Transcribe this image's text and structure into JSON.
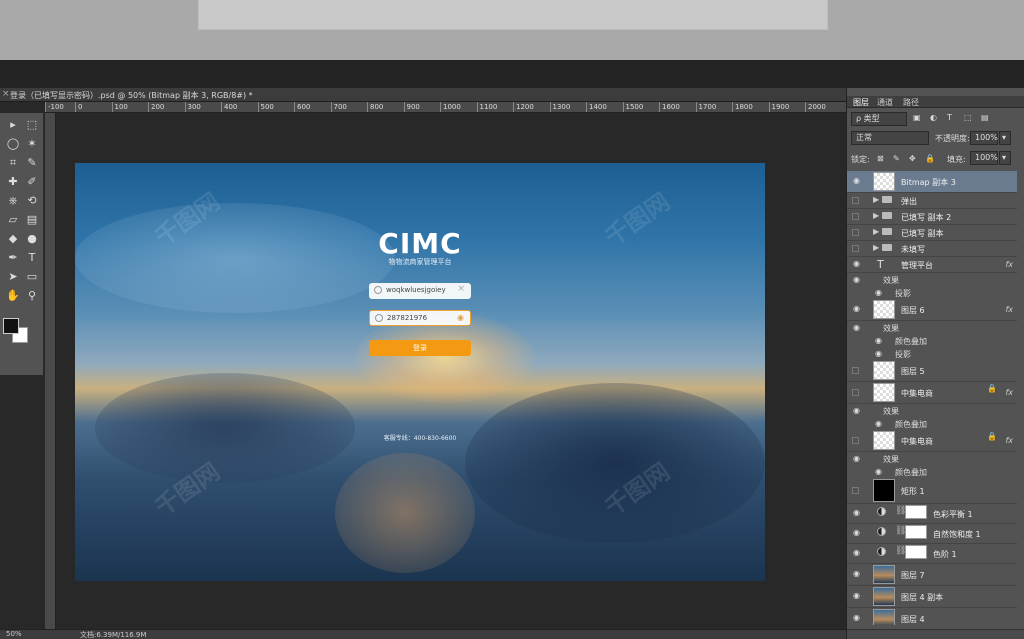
{
  "document": {
    "title": "登录（已填写显示密码）.psd @ 50% (Bitmap 副本 3, RGB/8#) *",
    "close_symbol": "×"
  },
  "ruler_labels": [
    "0",
    "100",
    "200",
    "300",
    "400",
    "500",
    "600",
    "700",
    "800",
    "900",
    "1000",
    "1100",
    "1200",
    "1300",
    "1400",
    "1500",
    "1600",
    "1700",
    "1800",
    "1900",
    "2000"
  ],
  "ruler_first": "-100",
  "tools": {
    "icons": [
      "move-icon",
      "marquee-icon",
      "lasso-icon",
      "magic-wand-icon",
      "crop-icon",
      "eyedropper-icon",
      "healing-brush-icon",
      "brush-icon",
      "clone-stamp-icon",
      "history-brush-icon",
      "eraser-icon",
      "gradient-icon",
      "blur-icon",
      "dodge-icon",
      "pen-icon",
      "type-icon",
      "path-select-icon",
      "shape-icon",
      "hand-icon",
      "zoom-icon"
    ],
    "glyphs": [
      "▸",
      "⬚",
      "◯",
      "✶",
      "⌗",
      "✎",
      "✚",
      "✐",
      "⎈",
      "⟲",
      "▱",
      "▤",
      "◆",
      "●",
      "✒",
      "T",
      "➤",
      "▭",
      "✋",
      "⚲"
    ],
    "foreground_color": "#111111",
    "background_color": "#ffffff"
  },
  "artboard": {
    "logo": "CIMC",
    "subtitle": "物物流商家管理平台",
    "username_value": "woqkwluesjgoiey",
    "password_value": "287821976",
    "clear_symbol": "×",
    "login_label": "登录",
    "hotline": "客服专线：400-830-6600",
    "accent_color": "#f39a12"
  },
  "panel": {
    "tabs": [
      "图层",
      "通道",
      "路径"
    ],
    "filter_kind": "ρ 类型",
    "filter_icons": [
      "image-filter-icon",
      "adjustment-filter-icon",
      "type-filter-icon",
      "shape-filter-icon",
      "smart-object-filter-icon"
    ],
    "filter_glyphs": [
      "▣",
      "◐",
      "T",
      "⬚",
      "▤"
    ],
    "blend_mode": "正常",
    "opacity_label": "不透明度:",
    "opacity_value": "100%",
    "lock_label": "锁定:",
    "lock_glyphs": [
      "⊠",
      "✎",
      "✥",
      "🔒"
    ],
    "fill_label": "填充:",
    "fill_value": "100%"
  },
  "layers": [
    {
      "name": "Bitmap 副本 3",
      "kind": "pixel",
      "visible": true,
      "selected": true
    },
    {
      "name": "弹出",
      "kind": "group",
      "visible": false
    },
    {
      "name": "已填写 副本 2",
      "kind": "group",
      "visible": false
    },
    {
      "name": "已填写 副本",
      "kind": "group",
      "visible": false
    },
    {
      "name": "未填写",
      "kind": "group",
      "visible": false
    },
    {
      "name": "管理平台",
      "kind": "type",
      "visible": true,
      "fx": "fx",
      "effects_label": "效果",
      "effects": [
        "投影"
      ]
    },
    {
      "name": "图层 6",
      "kind": "pixel",
      "visible": true,
      "fx": "fx",
      "effects_label": "效果",
      "effects": [
        "颜色叠加",
        "投影"
      ]
    },
    {
      "name": "图层 5",
      "kind": "pixel",
      "visible": false
    },
    {
      "name": "中集电商",
      "kind": "smart",
      "visible": false,
      "fx": "fx",
      "effects_label": "效果",
      "effects": [
        "颜色叠加"
      ]
    },
    {
      "name": "中集电商",
      "kind": "smart",
      "visible": false,
      "fx": "fx",
      "effects_label": "效果",
      "effects": [
        "颜色叠加"
      ]
    },
    {
      "name": "矩形 1",
      "kind": "black",
      "visible": false
    },
    {
      "name": "色彩平衡 1",
      "kind": "adjustment",
      "visible": true
    },
    {
      "name": "自然饱和度 1",
      "kind": "adjustment",
      "visible": true
    },
    {
      "name": "色阶 1",
      "kind": "adjustment",
      "visible": true
    },
    {
      "name": "图层 7",
      "kind": "photo",
      "visible": true
    },
    {
      "name": "图层 4 副本",
      "kind": "photo",
      "visible": true
    },
    {
      "name": "图层 4",
      "kind": "photo",
      "visible": true
    }
  ],
  "status": {
    "zoom": "50%",
    "doc_size": "文档:6.39M/116.9M"
  }
}
